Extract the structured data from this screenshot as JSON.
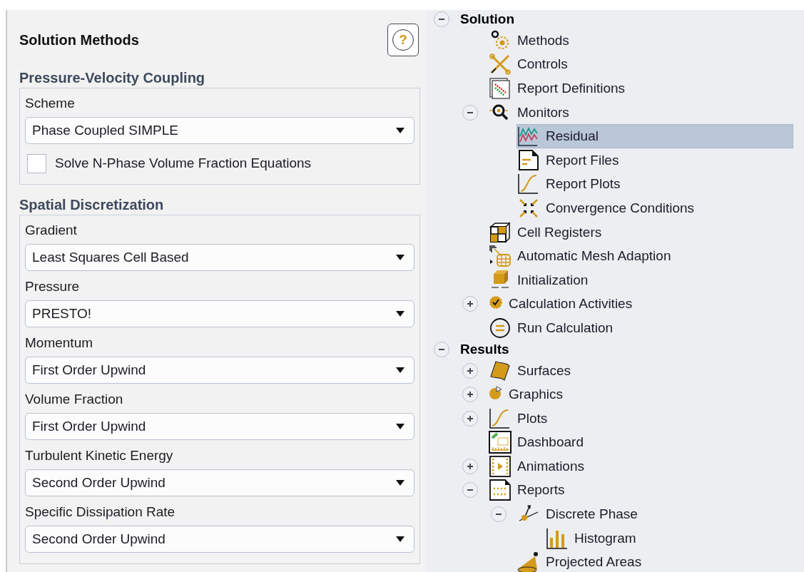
{
  "panel": {
    "title": "Solution Methods",
    "help_button": "?",
    "sections": [
      {
        "heading": "Pressure-Velocity Coupling",
        "fields": [
          {
            "kind": "dropdown",
            "label": "Scheme",
            "value": "Phase Coupled SIMPLE"
          },
          {
            "kind": "checkbox",
            "label": "Solve N-Phase Volume Fraction Equations",
            "checked": false
          }
        ]
      },
      {
        "heading": "Spatial Discretization",
        "fields": [
          {
            "kind": "dropdown",
            "label": "Gradient",
            "value": "Least Squares Cell Based"
          },
          {
            "kind": "dropdown",
            "label": "Pressure",
            "value": "PRESTO!"
          },
          {
            "kind": "dropdown",
            "label": "Momentum",
            "value": "First Order Upwind"
          },
          {
            "kind": "dropdown",
            "label": "Volume Fraction",
            "value": "First Order Upwind"
          },
          {
            "kind": "dropdown",
            "label": "Turbulent Kinetic Energy",
            "value": "Second Order Upwind"
          },
          {
            "kind": "dropdown",
            "label": "Specific Dissipation Rate",
            "value": "Second Order Upwind"
          }
        ]
      }
    ]
  },
  "tree": [
    {
      "label": "Solution",
      "expanded": true,
      "selected": false,
      "children": [
        {
          "label": "Methods",
          "kind": "gears",
          "selected": false
        },
        {
          "label": "Controls",
          "kind": "tools",
          "selected": false
        },
        {
          "label": "Report Definitions",
          "kind": "reportdefs",
          "selected": false
        },
        {
          "label": "Monitors",
          "kind": "magnifier",
          "expanded": true,
          "selected": false,
          "children": [
            {
              "label": "Residual",
              "kind": "residual",
              "selected": true
            },
            {
              "label": "Report Files",
              "kind": "file",
              "selected": false
            },
            {
              "label": "Report Plots",
              "kind": "curve",
              "selected": false
            },
            {
              "label": "Convergence Conditions",
              "kind": "converge",
              "selected": false
            }
          ]
        },
        {
          "label": "Cell Registers",
          "kind": "cells",
          "selected": false
        },
        {
          "label": "Automatic Mesh Adaption",
          "kind": "mesh",
          "selected": false
        },
        {
          "label": "Initialization",
          "kind": "init",
          "selected": false
        },
        {
          "label": "Calculation Activities",
          "kind": "activities",
          "expanded": false,
          "selected": false
        },
        {
          "label": "Run Calculation",
          "kind": "run",
          "selected": false
        }
      ]
    },
    {
      "label": "Results",
      "expanded": true,
      "selected": false,
      "children": [
        {
          "label": "Surfaces",
          "kind": "surface",
          "expanded": false,
          "selected": false
        },
        {
          "label": "Graphics",
          "kind": "pie",
          "expanded": false,
          "selected": false
        },
        {
          "label": "Plots",
          "kind": "curve",
          "expanded": false,
          "selected": false
        },
        {
          "label": "Dashboard",
          "kind": "dashboard",
          "selected": false
        },
        {
          "label": "Animations",
          "kind": "animation",
          "expanded": false,
          "selected": false
        },
        {
          "label": "Reports",
          "kind": "reports",
          "expanded": true,
          "selected": false,
          "children": [
            {
              "label": "Discrete Phase",
              "kind": "particle",
              "expanded": true,
              "selected": false,
              "children": [
                {
                  "label": "Histogram",
                  "kind": "histogram",
                  "selected": false
                }
              ]
            },
            {
              "label": "Projected Areas",
              "kind": "cone",
              "selected": false
            }
          ]
        }
      ]
    }
  ]
}
